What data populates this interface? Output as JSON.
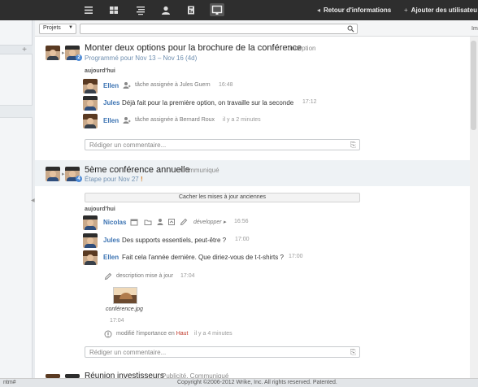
{
  "topbar": {
    "icons": [
      "menu-icon",
      "grid-icon",
      "list-icon",
      "user-icon",
      "report-icon",
      "stream-icon"
    ],
    "feedback_label": "Retour d'informations",
    "feedback_glyph": "◂",
    "add_users_label": "Ajouter des utilisateu",
    "add_users_glyph": "+"
  },
  "filterbar": {
    "projects_label": "Projets",
    "search_placeholder": "",
    "right_text": "Im"
  },
  "cards": [
    {
      "title": "Monter deux options pour la brochure de la conférence",
      "tag": "Conception",
      "schedule": "Programmé pour Nov 13 – Nov 16 (4d)",
      "badge": "2",
      "day_label": "aujourd'hui",
      "entries": [
        {
          "author": "Ellen",
          "action": "tâche assignée à Jules Guern",
          "time": "16:48"
        },
        {
          "author": "Jules",
          "message": "Déjà fait pour la première option, on travaille sur la seconde",
          "time": "17:12"
        },
        {
          "author": "Ellen",
          "action": "tâche assignée à Bernard Roux",
          "time": "il y a 2 minutes"
        }
      ],
      "comment_placeholder": "Rédiger un commentaire..."
    },
    {
      "title": "5ème conférence annuelle",
      "tag": "Communiqué",
      "schedule": "Étape pour Nov 27",
      "schedule_mark": "!",
      "badge": "4",
      "older_button": "Cacher les mises à jour anciennes",
      "day_label": "aujourd'hui",
      "entries": [
        {
          "author": "Nicolas",
          "expand": "développer ▸",
          "time": "16:56"
        },
        {
          "author": "Jules",
          "message": "Des supports essentiels, peut-être ?",
          "time": "17:00"
        },
        {
          "author": "Ellen",
          "message": "Fait cela l'année dernière. Que diriez-vous de t-t-shirts ?",
          "time": "17:00"
        }
      ],
      "description_update": {
        "text": "description mise à jour",
        "time": "17:04"
      },
      "attachment": {
        "file": "conférence.jpg",
        "time": "17:04"
      },
      "importance": {
        "prefix": "modifié l'importance en",
        "level": "Haut",
        "time": "il y a 4 minutes"
      },
      "comment_placeholder": "Rédiger un commentaire..."
    },
    {
      "title": "Réunion investisseurs",
      "tag": "Publicité, Communiqué"
    }
  ],
  "footer": {
    "left": "ntm#",
    "copyright": "Copyright ©2006-2012 Wrike, Inc. All rights reserved. Patented."
  },
  "colors": {
    "topbar": "#2e2e2e",
    "link_blue": "#3d74b3",
    "importance_red": "#c0392b",
    "badge_blue": "#4d8ad6"
  }
}
